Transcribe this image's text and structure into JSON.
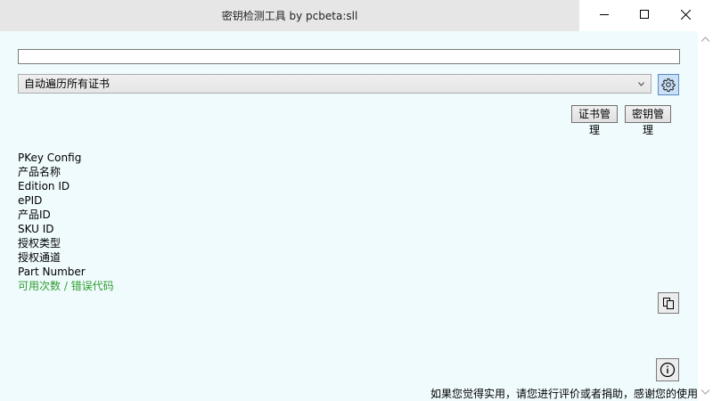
{
  "window": {
    "title": "密钥检测工具 by pcbeta:sll",
    "controls": {
      "minimize_icon": "minimize-icon",
      "maximize_icon": "maximize-icon",
      "close_icon": "close-icon"
    }
  },
  "key_input": {
    "value": "",
    "placeholder": ""
  },
  "cert_select": {
    "selected": "自动遍历所有证书",
    "icon": "chevron-down-icon"
  },
  "settings_button": {
    "icon": "gear-icon"
  },
  "buttons": {
    "cert_manage": "证书管理",
    "key_manage": "密钥管理"
  },
  "info_fields": [
    "PKey Config",
    "产品名称",
    "Edition ID",
    "ePID",
    "产品ID",
    "SKU ID",
    "授权类型",
    "授权通道",
    "Part Number",
    "可用次数 / 错误代码"
  ],
  "copy_button": {
    "icon": "copy-icon"
  },
  "about_button": {
    "icon": "info-icon"
  },
  "footer": "如果您觉得实用，请您进行评价或者捐助，感谢您的使用",
  "colors": {
    "client_bg": "#f0fbfd",
    "titlebar_bg": "#e6e6e6",
    "status_green": "#2e9d2e",
    "accent_blue": "#5a8bc0"
  }
}
